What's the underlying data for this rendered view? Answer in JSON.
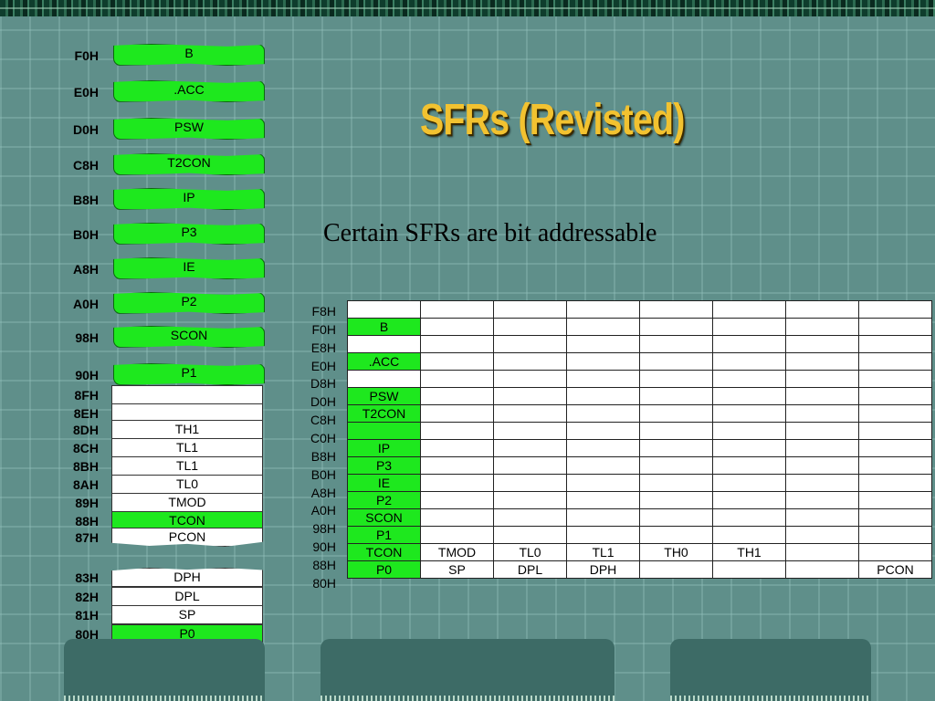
{
  "slide": {
    "title": "SFRs (Revisted)",
    "subtitle": "Certain SFRs are bit addressable"
  },
  "colors": {
    "green": "#1ee81e",
    "title": "#f2c230",
    "background": "#5f8f8a"
  },
  "left_stack": {
    "bit_addressable": [
      {
        "addr": "F0H",
        "name": "B"
      },
      {
        "addr": "E0H",
        "name": ".ACC"
      },
      {
        "addr": "D0H",
        "name": "PSW"
      },
      {
        "addr": "C8H",
        "name": "T2CON"
      },
      {
        "addr": "B8H",
        "name": "IP"
      },
      {
        "addr": "B0H",
        "name": "P3"
      },
      {
        "addr": "A8H",
        "name": "IE"
      },
      {
        "addr": "A0H",
        "name": "P2"
      },
      {
        "addr": "98H",
        "name": "SCON"
      },
      {
        "addr": "90H",
        "name": "P1"
      }
    ],
    "boxes": [
      {
        "addr": "8FH",
        "name": "",
        "green": false
      },
      {
        "addr": "8EH",
        "name": "",
        "green": false
      },
      {
        "addr": "8DH",
        "name": "TH1",
        "green": false
      },
      {
        "addr": "8CH",
        "name": "TL1",
        "green": false
      },
      {
        "addr": "8BH",
        "name": "TL1",
        "green": false
      },
      {
        "addr": "8AH",
        "name": "TL0",
        "green": false
      },
      {
        "addr": "89H",
        "name": "TMOD",
        "green": false
      },
      {
        "addr": "88H",
        "name": "TCON",
        "green": true
      },
      {
        "addr": "87H",
        "name": "PCON",
        "green": false
      }
    ],
    "lower_boxes": [
      {
        "addr": "83H",
        "name": "DPH",
        "green": false
      },
      {
        "addr": "82H",
        "name": "DPL",
        "green": false
      },
      {
        "addr": "81H",
        "name": "SP",
        "green": false
      },
      {
        "addr": "80H",
        "name": "P0",
        "green": true
      }
    ]
  },
  "sfr_table": {
    "rows": [
      {
        "addr": "F8H",
        "cells": [
          "",
          "",
          "",
          "",
          "",
          "",
          "",
          ""
        ],
        "green": false
      },
      {
        "addr": "F0H",
        "cells": [
          "B",
          "",
          "",
          "",
          "",
          "",
          "",
          ""
        ],
        "green": true
      },
      {
        "addr": "E8H",
        "cells": [
          "",
          "",
          "",
          "",
          "",
          "",
          "",
          ""
        ],
        "green": false
      },
      {
        "addr": "E0H",
        "cells": [
          ".ACC",
          "",
          "",
          "",
          "",
          "",
          "",
          ""
        ],
        "green": true
      },
      {
        "addr": "D8H",
        "cells": [
          "",
          "",
          "",
          "",
          "",
          "",
          "",
          ""
        ],
        "green": false
      },
      {
        "addr": "D0H",
        "cells": [
          "PSW",
          "",
          "",
          "",
          "",
          "",
          "",
          ""
        ],
        "green": true
      },
      {
        "addr": "C8H",
        "cells": [
          "T2CON",
          "",
          "",
          "",
          "",
          "",
          "",
          ""
        ],
        "green": true
      },
      {
        "addr": "C0H",
        "cells": [
          "",
          "",
          "",
          "",
          "",
          "",
          "",
          ""
        ],
        "green": true
      },
      {
        "addr": "B8H",
        "cells": [
          "IP",
          "",
          "",
          "",
          "",
          "",
          "",
          ""
        ],
        "green": true
      },
      {
        "addr": "B0H",
        "cells": [
          "P3",
          "",
          "",
          "",
          "",
          "",
          "",
          ""
        ],
        "green": true
      },
      {
        "addr": "A8H",
        "cells": [
          "IE",
          "",
          "",
          "",
          "",
          "",
          "",
          ""
        ],
        "green": true
      },
      {
        "addr": "A0H",
        "cells": [
          "P2",
          "",
          "",
          "",
          "",
          "",
          "",
          ""
        ],
        "green": true
      },
      {
        "addr": "98H",
        "cells": [
          "SCON",
          "",
          "",
          "",
          "",
          "",
          "",
          ""
        ],
        "green": true
      },
      {
        "addr": "90H",
        "cells": [
          "P1",
          "",
          "",
          "",
          "",
          "",
          "",
          ""
        ],
        "green": true
      },
      {
        "addr": "88H",
        "cells": [
          "TCON",
          "TMOD",
          "TL0",
          "TL1",
          "TH0",
          "TH1",
          "",
          ""
        ],
        "green": true
      },
      {
        "addr": "80H",
        "cells": [
          "P0",
          "SP",
          "DPL",
          "DPH",
          "",
          "",
          "",
          "PCON"
        ],
        "green": true
      }
    ]
  }
}
